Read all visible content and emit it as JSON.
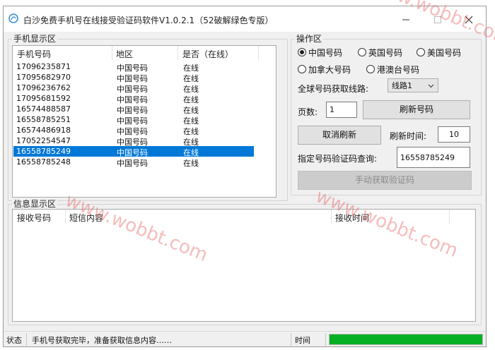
{
  "window": {
    "title": "白沙免费手机号在线接受验证码软件V1.0.2.1（52破解绿色专版）",
    "controls": {
      "minimize": "–",
      "maximize": "☐",
      "close": "✕"
    }
  },
  "phone_panel": {
    "label": "手机显示区",
    "columns": [
      "手机号码",
      "地区",
      "是否（在线）"
    ],
    "rows": [
      {
        "phone": "17096235871",
        "region": "中国号码",
        "status": "在线",
        "selected": false
      },
      {
        "phone": "17095682970",
        "region": "中国号码",
        "status": "在线",
        "selected": false
      },
      {
        "phone": "17096236762",
        "region": "中国号码",
        "status": "在线",
        "selected": false
      },
      {
        "phone": "17095681592",
        "region": "中国号码",
        "status": "在线",
        "selected": false
      },
      {
        "phone": "16574488587",
        "region": "中国号码",
        "status": "在线",
        "selected": false
      },
      {
        "phone": "16558785251",
        "region": "中国号码",
        "status": "在线",
        "selected": false
      },
      {
        "phone": "16574486918",
        "region": "中国号码",
        "status": "在线",
        "selected": false
      },
      {
        "phone": "17052254547",
        "region": "中国号码",
        "status": "在线",
        "selected": false
      },
      {
        "phone": "16558785249",
        "region": "中国号码",
        "status": "在线",
        "selected": true
      },
      {
        "phone": "16558785248",
        "region": "中国号码",
        "status": "在线",
        "selected": false
      }
    ]
  },
  "ops_panel": {
    "label": "操作区",
    "radios": [
      {
        "label": "中国号码",
        "checked": true
      },
      {
        "label": "英国号码",
        "checked": false
      },
      {
        "label": "美国号码",
        "checked": false
      },
      {
        "label": "加拿大号码",
        "checked": false
      },
      {
        "label": "港澳台号码",
        "checked": false
      }
    ],
    "route_label": "全球号码获取线路:",
    "route_value": "线路1",
    "page_label": "页数:",
    "page_value": "1",
    "refresh_numbers_button": "刷新号码",
    "cancel_refresh_button": "取消刷新",
    "refresh_time_label": "刷新时间:",
    "refresh_time_value": "10",
    "query_label": "指定号码验证码查询:",
    "query_value": "16558785249",
    "manual_fetch_button": "手动获取验证码"
  },
  "info_panel": {
    "label": "信息显示区",
    "columns": [
      "接收号码",
      "短信内容",
      "接收时间"
    ]
  },
  "statusbar": {
    "state_label": "状态",
    "message": "手机号获取完毕，准备获取信息内容……",
    "time_label": "时间",
    "progress_fraction": 1.0
  },
  "watermark": "www.wobbt.com",
  "colors": {
    "selection": "#0078d7",
    "progress": "#06b025",
    "watermark": "#e65f5f"
  }
}
